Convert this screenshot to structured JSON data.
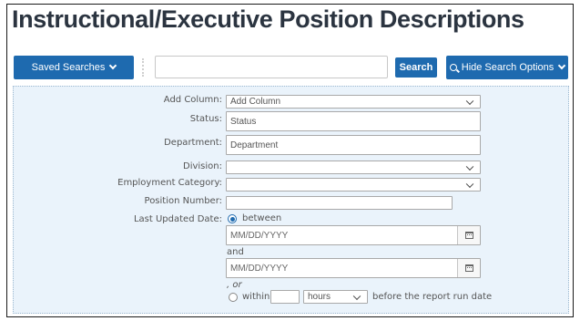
{
  "header": {
    "title": "Instructional/Executive Position Descriptions"
  },
  "toolbar": {
    "saved_searches_label": "Saved Searches",
    "search_value": "",
    "search_button_label": "Search",
    "hide_options_label": "Hide Search Options"
  },
  "filters": {
    "add_column": {
      "label": "Add Column:",
      "value": "Add Column"
    },
    "status": {
      "label": "Status:",
      "placeholder": "Status"
    },
    "department": {
      "label": "Department:",
      "placeholder": "Department"
    },
    "division": {
      "label": "Division:",
      "value": ""
    },
    "employment_category": {
      "label": "Employment Category:",
      "value": ""
    },
    "position_number": {
      "label": "Position Number:",
      "value": ""
    },
    "last_updated": {
      "label": "Last Updated Date:",
      "between_label": "between",
      "from_placeholder": "MM/DD/YYYY",
      "and_label": "and",
      "to_placeholder": "MM/DD/YYYY",
      "or_label": ", or",
      "within_label": "within",
      "within_value": "",
      "unit_value": "hours",
      "suffix": "before the report run date",
      "selected": "between"
    }
  },
  "colors": {
    "accent": "#1e6aaf",
    "panel_bg": "#eaf3fb",
    "title": "#2b3440"
  },
  "icons": [
    "chevron-down-icon",
    "search-icon",
    "calendar-icon"
  ]
}
